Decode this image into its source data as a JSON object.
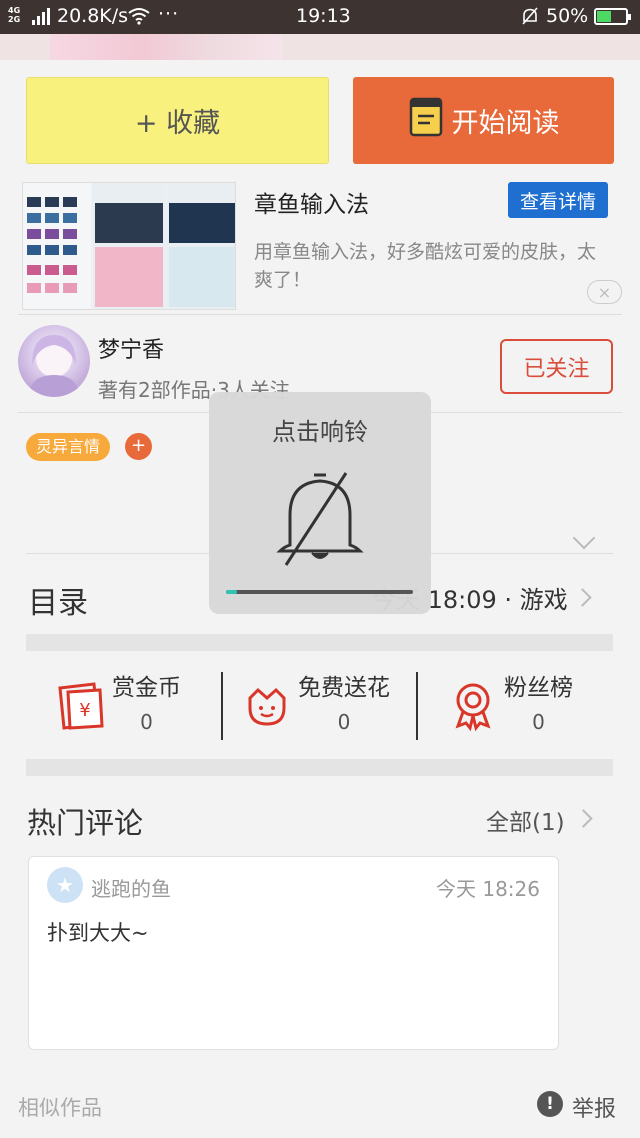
{
  "status_bar": {
    "network": "4G\n2G",
    "speed": "20.8K/s",
    "dots": "···",
    "time": "19:13",
    "battery": "50%",
    "battery_level": 0.5
  },
  "actions": {
    "favorite_label": "+ 收藏",
    "read_label": "开始阅读"
  },
  "ad": {
    "title": "章鱼输入法",
    "button": "查看详情",
    "description": "用章鱼输入法，好多酷炫可爱的皮肤，太爽了！",
    "close": "×"
  },
  "author": {
    "name": "梦宁香",
    "meta": "著有2部作品·3人关注",
    "follow_label": "已关注"
  },
  "tags": {
    "genre": "灵异言情",
    "add": "+"
  },
  "toc": {
    "label": "目录",
    "latest": "今天 18:09 · 游戏"
  },
  "rewards": [
    {
      "label": "赏金币",
      "value": "0",
      "icon": "red-envelope-icon"
    },
    {
      "label": "免费送花",
      "value": "0",
      "icon": "flower-icon"
    },
    {
      "label": "粉丝榜",
      "value": "0",
      "icon": "medal-icon"
    }
  ],
  "comments": {
    "title": "热门评论",
    "all_label": "全部(1)",
    "items": [
      {
        "user": "逃跑的鱼",
        "time": "今天 18:26",
        "text": "扑到大大~"
      }
    ]
  },
  "footer": {
    "similar": "相似作品",
    "report": "举报"
  },
  "ringer_overlay": {
    "title": "点击响铃",
    "volume_level": 0.06
  },
  "colors": {
    "favorite_bg": "#f8f17d",
    "read_bg": "#e8693a",
    "follow_accent": "#d94d3a",
    "ad_button": "#1f6fd1",
    "tag": "#f7a93b"
  }
}
